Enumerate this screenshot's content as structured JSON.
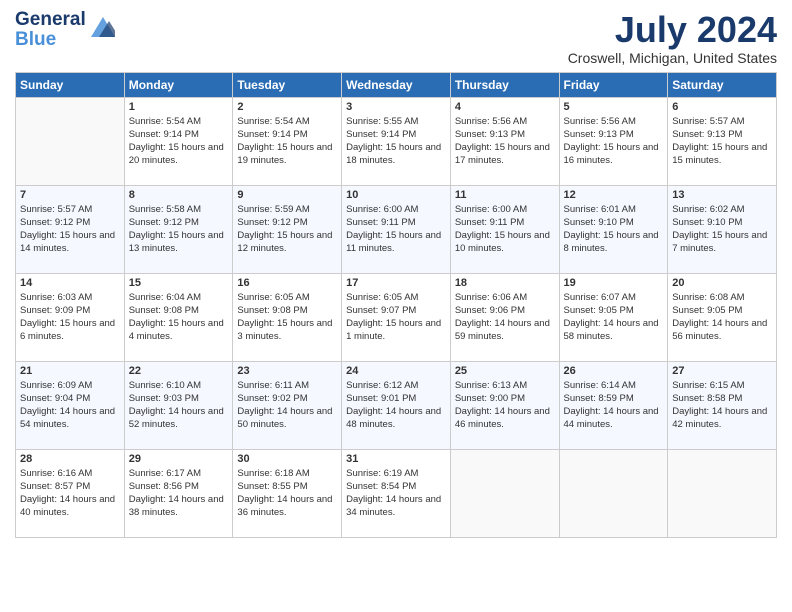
{
  "header": {
    "logo_line1": "General",
    "logo_line2": "Blue",
    "month_title": "July 2024",
    "location": "Croswell, Michigan, United States"
  },
  "days_of_week": [
    "Sunday",
    "Monday",
    "Tuesday",
    "Wednesday",
    "Thursday",
    "Friday",
    "Saturday"
  ],
  "weeks": [
    [
      {
        "day": "",
        "sunrise": "",
        "sunset": "",
        "daylight": "",
        "empty": true
      },
      {
        "day": "1",
        "sunrise": "Sunrise: 5:54 AM",
        "sunset": "Sunset: 9:14 PM",
        "daylight": "Daylight: 15 hours and 20 minutes."
      },
      {
        "day": "2",
        "sunrise": "Sunrise: 5:54 AM",
        "sunset": "Sunset: 9:14 PM",
        "daylight": "Daylight: 15 hours and 19 minutes."
      },
      {
        "day": "3",
        "sunrise": "Sunrise: 5:55 AM",
        "sunset": "Sunset: 9:14 PM",
        "daylight": "Daylight: 15 hours and 18 minutes."
      },
      {
        "day": "4",
        "sunrise": "Sunrise: 5:56 AM",
        "sunset": "Sunset: 9:13 PM",
        "daylight": "Daylight: 15 hours and 17 minutes."
      },
      {
        "day": "5",
        "sunrise": "Sunrise: 5:56 AM",
        "sunset": "Sunset: 9:13 PM",
        "daylight": "Daylight: 15 hours and 16 minutes."
      },
      {
        "day": "6",
        "sunrise": "Sunrise: 5:57 AM",
        "sunset": "Sunset: 9:13 PM",
        "daylight": "Daylight: 15 hours and 15 minutes."
      }
    ],
    [
      {
        "day": "7",
        "sunrise": "Sunrise: 5:57 AM",
        "sunset": "Sunset: 9:12 PM",
        "daylight": "Daylight: 15 hours and 14 minutes."
      },
      {
        "day": "8",
        "sunrise": "Sunrise: 5:58 AM",
        "sunset": "Sunset: 9:12 PM",
        "daylight": "Daylight: 15 hours and 13 minutes."
      },
      {
        "day": "9",
        "sunrise": "Sunrise: 5:59 AM",
        "sunset": "Sunset: 9:12 PM",
        "daylight": "Daylight: 15 hours and 12 minutes."
      },
      {
        "day": "10",
        "sunrise": "Sunrise: 6:00 AM",
        "sunset": "Sunset: 9:11 PM",
        "daylight": "Daylight: 15 hours and 11 minutes."
      },
      {
        "day": "11",
        "sunrise": "Sunrise: 6:00 AM",
        "sunset": "Sunset: 9:11 PM",
        "daylight": "Daylight: 15 hours and 10 minutes."
      },
      {
        "day": "12",
        "sunrise": "Sunrise: 6:01 AM",
        "sunset": "Sunset: 9:10 PM",
        "daylight": "Daylight: 15 hours and 8 minutes."
      },
      {
        "day": "13",
        "sunrise": "Sunrise: 6:02 AM",
        "sunset": "Sunset: 9:10 PM",
        "daylight": "Daylight: 15 hours and 7 minutes."
      }
    ],
    [
      {
        "day": "14",
        "sunrise": "Sunrise: 6:03 AM",
        "sunset": "Sunset: 9:09 PM",
        "daylight": "Daylight: 15 hours and 6 minutes."
      },
      {
        "day": "15",
        "sunrise": "Sunrise: 6:04 AM",
        "sunset": "Sunset: 9:08 PM",
        "daylight": "Daylight: 15 hours and 4 minutes."
      },
      {
        "day": "16",
        "sunrise": "Sunrise: 6:05 AM",
        "sunset": "Sunset: 9:08 PM",
        "daylight": "Daylight: 15 hours and 3 minutes."
      },
      {
        "day": "17",
        "sunrise": "Sunrise: 6:05 AM",
        "sunset": "Sunset: 9:07 PM",
        "daylight": "Daylight: 15 hours and 1 minute."
      },
      {
        "day": "18",
        "sunrise": "Sunrise: 6:06 AM",
        "sunset": "Sunset: 9:06 PM",
        "daylight": "Daylight: 14 hours and 59 minutes."
      },
      {
        "day": "19",
        "sunrise": "Sunrise: 6:07 AM",
        "sunset": "Sunset: 9:05 PM",
        "daylight": "Daylight: 14 hours and 58 minutes."
      },
      {
        "day": "20",
        "sunrise": "Sunrise: 6:08 AM",
        "sunset": "Sunset: 9:05 PM",
        "daylight": "Daylight: 14 hours and 56 minutes."
      }
    ],
    [
      {
        "day": "21",
        "sunrise": "Sunrise: 6:09 AM",
        "sunset": "Sunset: 9:04 PM",
        "daylight": "Daylight: 14 hours and 54 minutes."
      },
      {
        "day": "22",
        "sunrise": "Sunrise: 6:10 AM",
        "sunset": "Sunset: 9:03 PM",
        "daylight": "Daylight: 14 hours and 52 minutes."
      },
      {
        "day": "23",
        "sunrise": "Sunrise: 6:11 AM",
        "sunset": "Sunset: 9:02 PM",
        "daylight": "Daylight: 14 hours and 50 minutes."
      },
      {
        "day": "24",
        "sunrise": "Sunrise: 6:12 AM",
        "sunset": "Sunset: 9:01 PM",
        "daylight": "Daylight: 14 hours and 48 minutes."
      },
      {
        "day": "25",
        "sunrise": "Sunrise: 6:13 AM",
        "sunset": "Sunset: 9:00 PM",
        "daylight": "Daylight: 14 hours and 46 minutes."
      },
      {
        "day": "26",
        "sunrise": "Sunrise: 6:14 AM",
        "sunset": "Sunset: 8:59 PM",
        "daylight": "Daylight: 14 hours and 44 minutes."
      },
      {
        "day": "27",
        "sunrise": "Sunrise: 6:15 AM",
        "sunset": "Sunset: 8:58 PM",
        "daylight": "Daylight: 14 hours and 42 minutes."
      }
    ],
    [
      {
        "day": "28",
        "sunrise": "Sunrise: 6:16 AM",
        "sunset": "Sunset: 8:57 PM",
        "daylight": "Daylight: 14 hours and 40 minutes."
      },
      {
        "day": "29",
        "sunrise": "Sunrise: 6:17 AM",
        "sunset": "Sunset: 8:56 PM",
        "daylight": "Daylight: 14 hours and 38 minutes."
      },
      {
        "day": "30",
        "sunrise": "Sunrise: 6:18 AM",
        "sunset": "Sunset: 8:55 PM",
        "daylight": "Daylight: 14 hours and 36 minutes."
      },
      {
        "day": "31",
        "sunrise": "Sunrise: 6:19 AM",
        "sunset": "Sunset: 8:54 PM",
        "daylight": "Daylight: 14 hours and 34 minutes."
      },
      {
        "day": "",
        "sunrise": "",
        "sunset": "",
        "daylight": "",
        "empty": true
      },
      {
        "day": "",
        "sunrise": "",
        "sunset": "",
        "daylight": "",
        "empty": true
      },
      {
        "day": "",
        "sunrise": "",
        "sunset": "",
        "daylight": "",
        "empty": true
      }
    ]
  ]
}
